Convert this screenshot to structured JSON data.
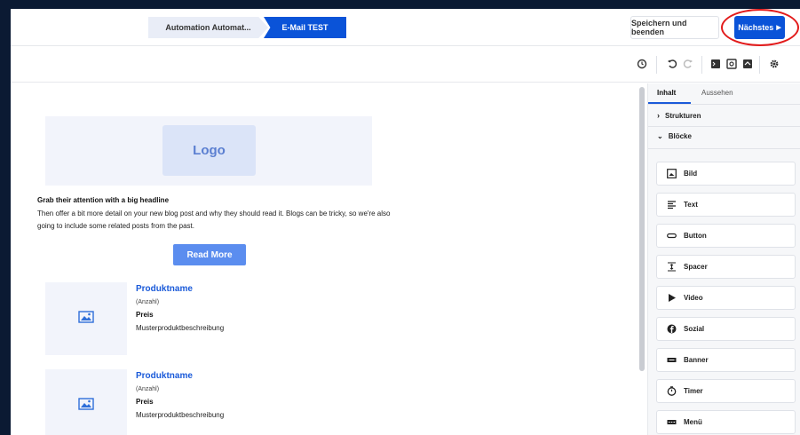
{
  "header": {
    "steps": [
      {
        "label": "Automation Automat..."
      },
      {
        "label": "E-Mail TEST"
      }
    ],
    "save_label": "Speichern und beenden",
    "next_label": "Nächstes"
  },
  "toolbar": {
    "icons": [
      "history-icon",
      "undo-icon",
      "redo-icon",
      "desktop-preview-icon",
      "mobile-preview-icon",
      "send-test-icon",
      "settings-icon"
    ]
  },
  "canvas": {
    "logo_label": "Logo",
    "headline": "Grab their attention with a big headline",
    "body_text": "Then offer a bit more detail on your new blog post and why they should read it. Blogs can be tricky, so we're also going to include some related posts from the past.",
    "button_label": "Read More",
    "products": [
      {
        "name": "Produktname",
        "qty": "(Anzahl)",
        "price": "Preis",
        "desc": "Musterproduktbeschreibung"
      },
      {
        "name": "Produktname",
        "qty": "(Anzahl)",
        "price": "Preis",
        "desc": "Musterproduktbeschreibung"
      }
    ]
  },
  "sidebar": {
    "tabs": [
      "Inhalt",
      "Aussehen"
    ],
    "sections": [
      {
        "label": "Strukturen",
        "expanded": false
      },
      {
        "label": "Blöcke",
        "expanded": true
      }
    ],
    "blocks": [
      {
        "label": "Bild",
        "icon": "image-icon"
      },
      {
        "label": "Text",
        "icon": "text-icon"
      },
      {
        "label": "Button",
        "icon": "button-icon"
      },
      {
        "label": "Spacer",
        "icon": "spacer-icon"
      },
      {
        "label": "Video",
        "icon": "play-icon"
      },
      {
        "label": "Sozial",
        "icon": "facebook-icon"
      },
      {
        "label": "Banner",
        "icon": "banner-icon"
      },
      {
        "label": "Timer",
        "icon": "timer-icon"
      },
      {
        "label": "Menü",
        "icon": "menu-icon"
      }
    ]
  },
  "colors": {
    "accent": "#0a53d8",
    "highlight_ring": "#e21b1b",
    "product_name": "#1a5ad9"
  }
}
